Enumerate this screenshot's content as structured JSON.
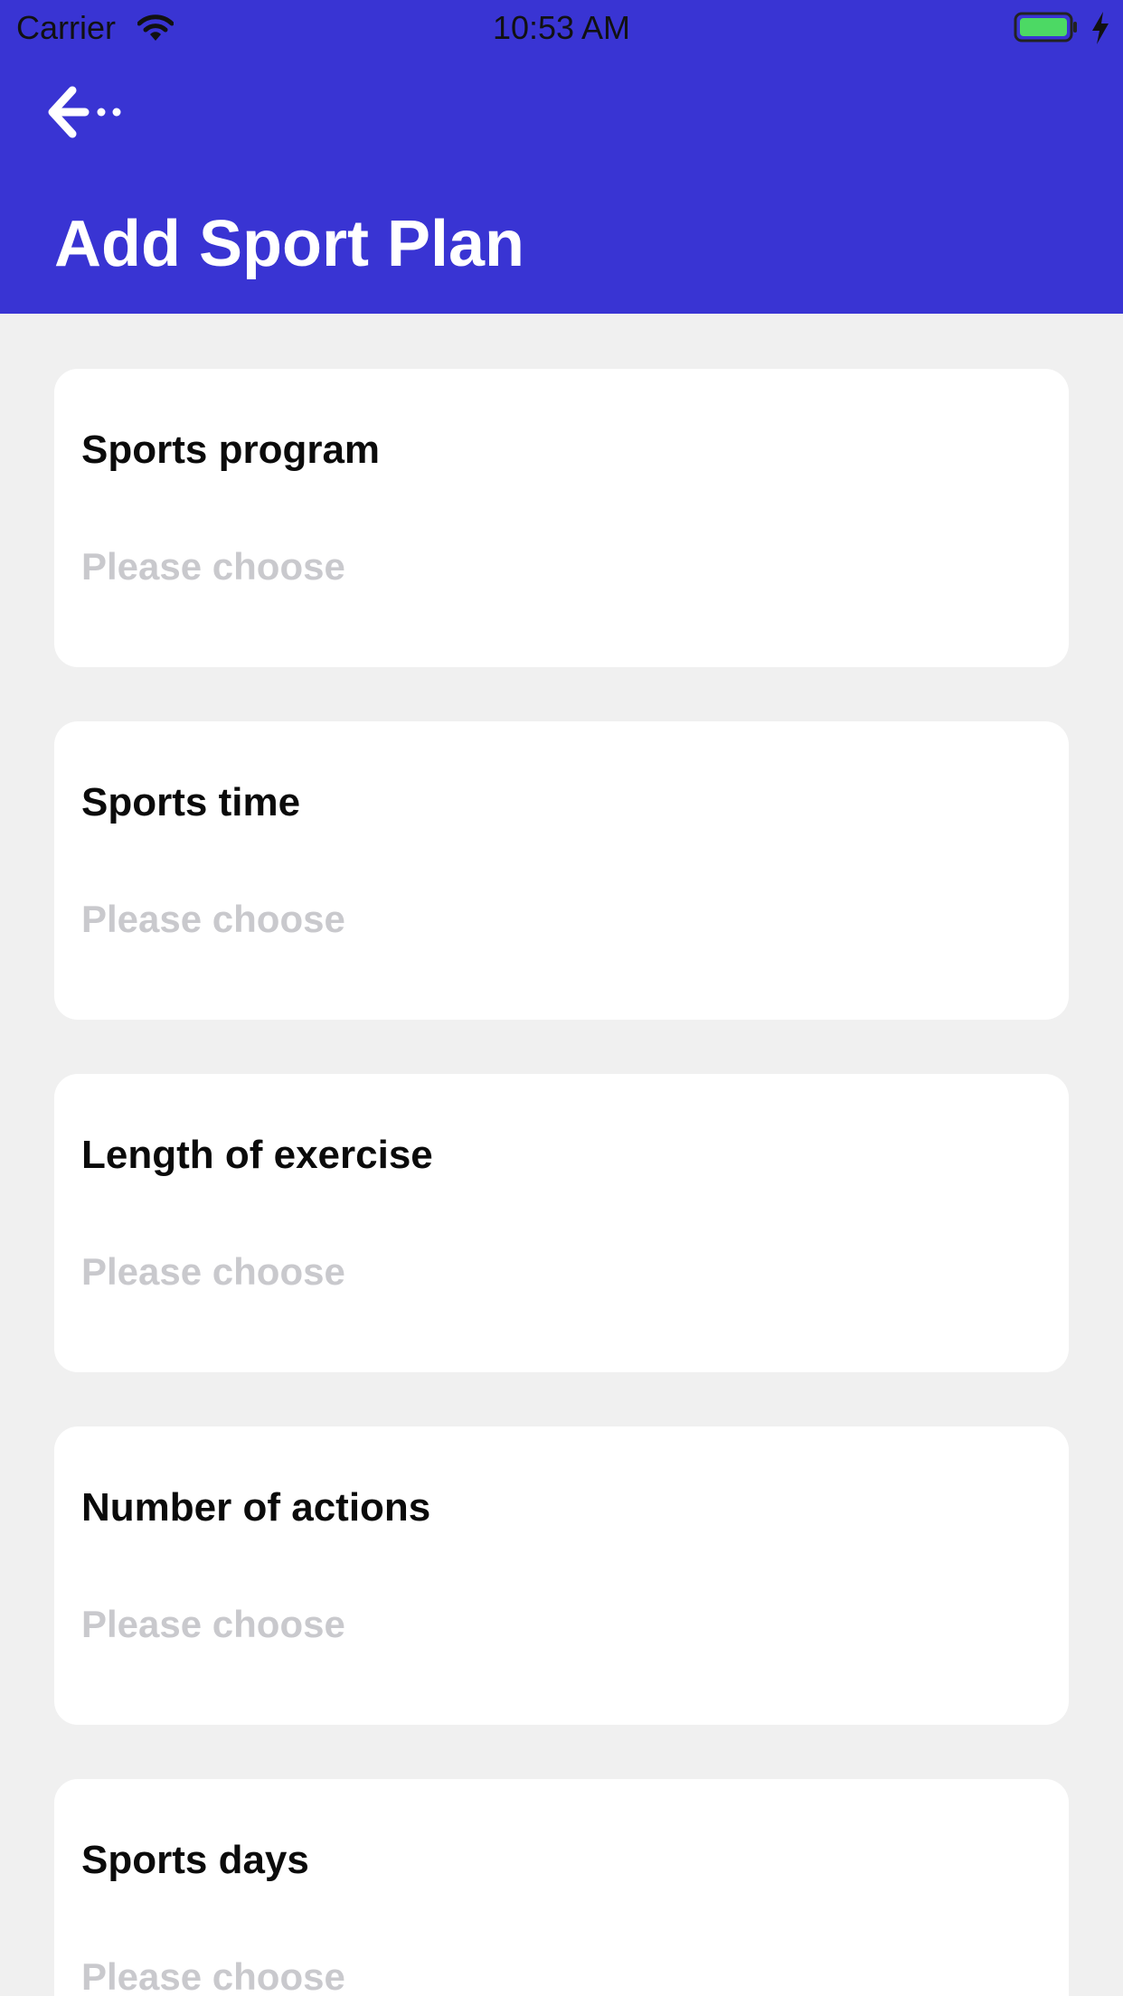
{
  "status_bar": {
    "carrier": "Carrier",
    "time": "10:53 AM",
    "battery_color": "#4cd964"
  },
  "header": {
    "title": "Add Sport Plan",
    "background_color": "#3934d3",
    "back_icon": "arrow-left-icon"
  },
  "form": {
    "fields": [
      {
        "label": "Sports program",
        "placeholder": "Please choose"
      },
      {
        "label": "Sports time",
        "placeholder": "Please choose"
      },
      {
        "label": "Length of exercise",
        "placeholder": "Please choose"
      },
      {
        "label": "Number of actions",
        "placeholder": "Please choose"
      },
      {
        "label": "Sports days",
        "placeholder": "Please choose"
      }
    ]
  }
}
